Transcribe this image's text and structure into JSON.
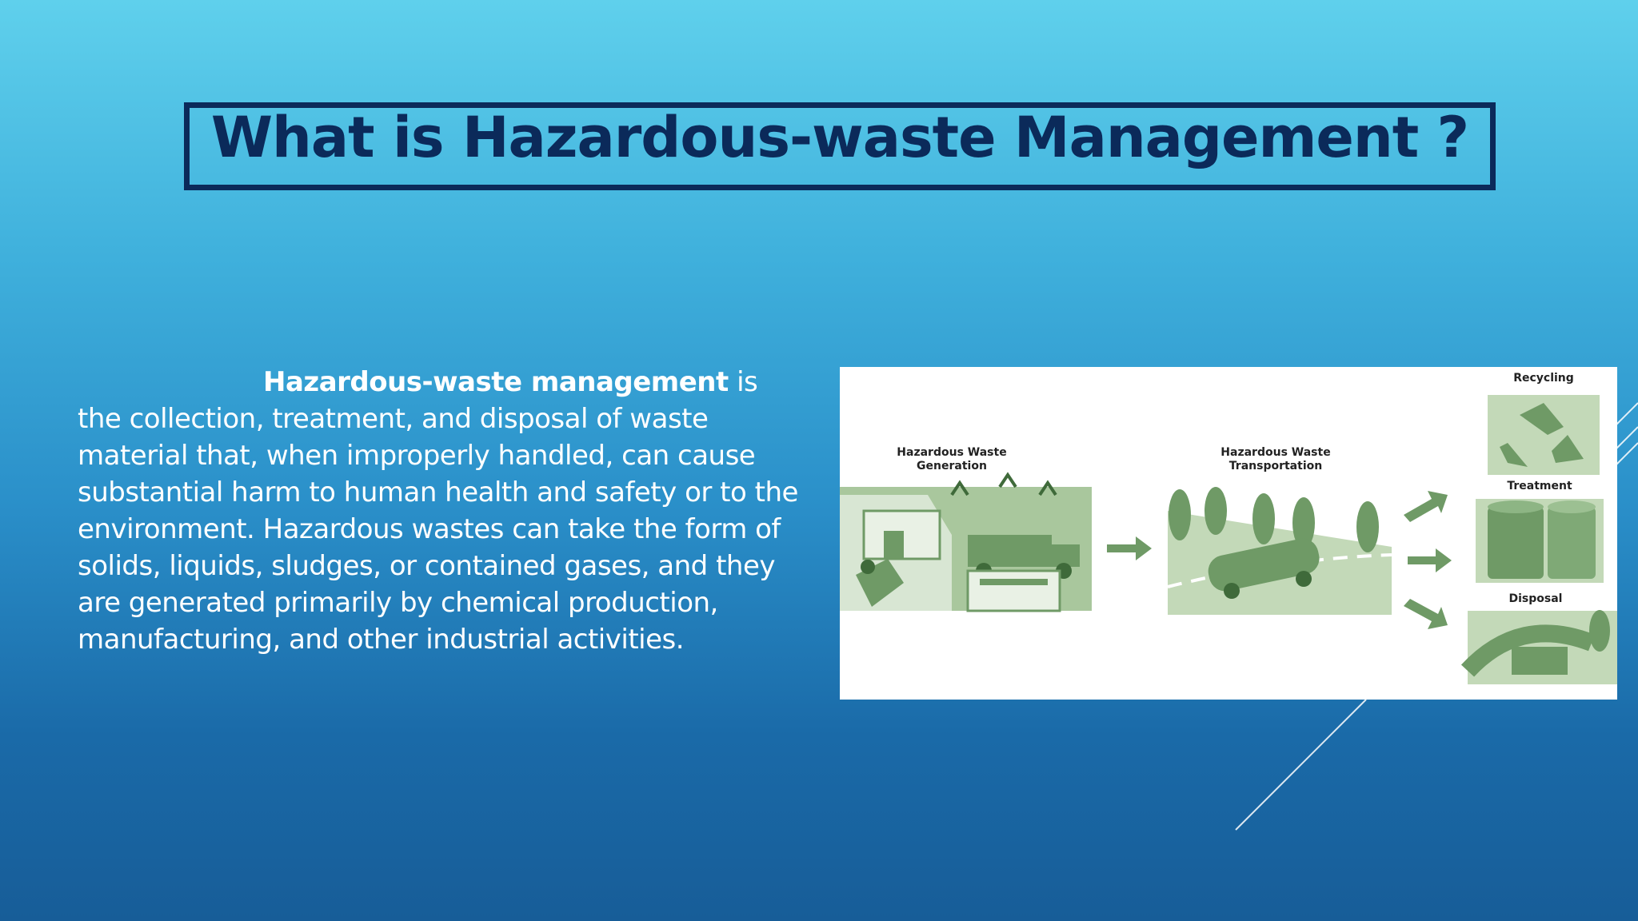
{
  "slide": {
    "title": "What is Hazardous-waste Management ?",
    "lead_bold": "Hazardous-waste management",
    "lead_rest": " is the collection, treatment, and disposal of waste material that, when improperly handled, can cause substantial harm to human health and safety or to the environment. Hazardous wastes can take the form of solids, liquids, sludges, or contained gases, and they are generated primarily by chemical production, manufacturing, and other industrial activities."
  },
  "diagram": {
    "generation_label": "Hazardous Waste Generation",
    "transportation_label": "Hazardous Waste Transportation",
    "recycling_label": "Recycling",
    "treatment_label": "Treatment",
    "disposal_label": "Disposal",
    "accent_green": "#6f9a66",
    "light_green": "#a9c79d"
  }
}
